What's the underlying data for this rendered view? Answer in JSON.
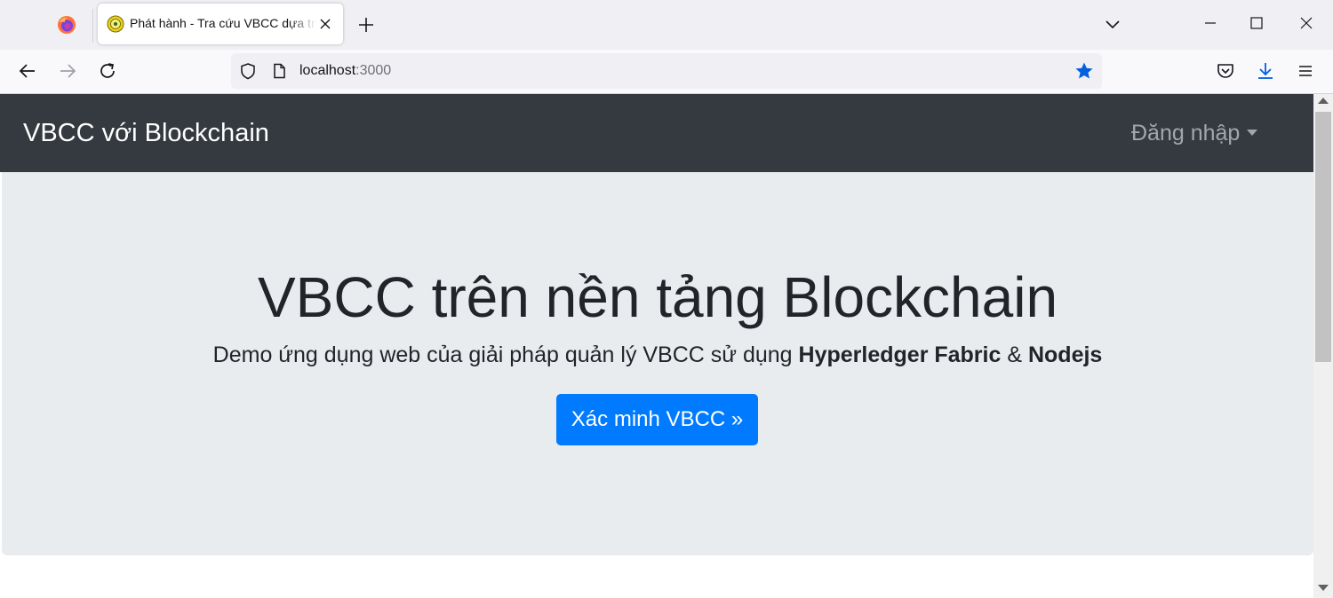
{
  "browser": {
    "tab_title": "Phát hành - Tra cứu VBCC dựa trên Blockchain",
    "url_host": "localhost",
    "url_port": ":3000",
    "accent_color": "#0060df"
  },
  "site": {
    "brand": "VBCC với Blockchain",
    "login_label": "Đăng nhập",
    "nav_color": "#343a40"
  },
  "hero": {
    "title": "VBCC trên nền tảng Blockchain",
    "lead_prefix": "Demo ứng dụng web của giải pháp quản lý VBCC sử dụng ",
    "lead_bold_1": "Hyperledger Fabric",
    "lead_amp": " & ",
    "lead_bold_2": "Nodejs",
    "button_label": "Xác minh VBCC »",
    "button_color": "#007bff"
  },
  "icons": {
    "firefox": "firefox-icon",
    "favicon": "site-favicon-icon",
    "close_tab": "close-icon",
    "new_tab": "plus-icon",
    "tab_list": "chevron-down-icon",
    "back": "arrow-left-icon",
    "forward": "arrow-right-icon",
    "reload": "reload-icon",
    "tracking": "shield-icon",
    "page": "page-icon",
    "bookmark": "star-icon",
    "pocket": "pocket-icon",
    "downloads": "download-icon",
    "menu": "hamburger-icon"
  }
}
